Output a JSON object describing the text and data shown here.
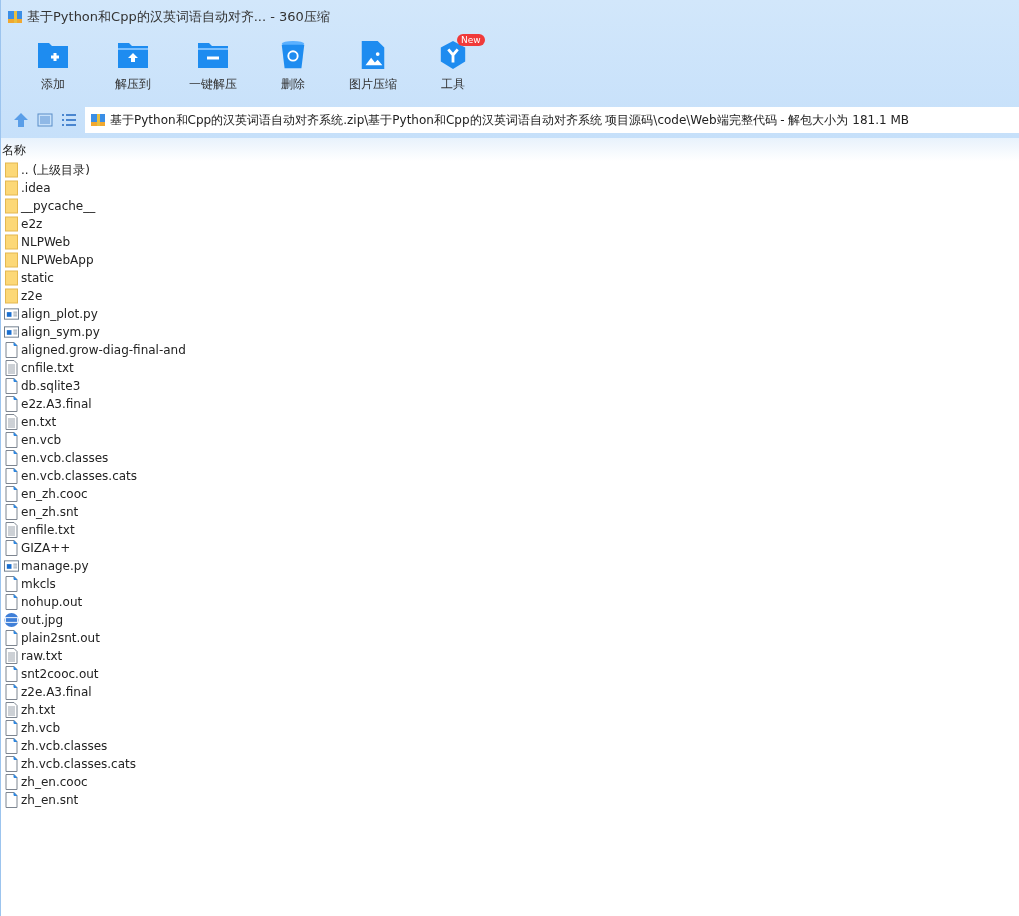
{
  "window": {
    "title": "基于Python和Cpp的汉英词语自动对齐... - 360压缩"
  },
  "toolbar": [
    {
      "kind": "add",
      "label": "添加"
    },
    {
      "kind": "extract",
      "label": "解压到"
    },
    {
      "kind": "oneclick",
      "label": "一键解压"
    },
    {
      "kind": "delete",
      "label": "删除"
    },
    {
      "kind": "image",
      "label": "图片压缩"
    },
    {
      "kind": "tools",
      "label": "工具",
      "badge": "New"
    }
  ],
  "address_bar": {
    "path": "基于Python和Cpp的汉英词语自动对齐系统.zip\\基于Python和Cpp的汉英词语自动对齐系统 项目源码\\code\\Web端完整代码 - 解包大小为 181.1 MB"
  },
  "file_list": {
    "columns": [
      "名称"
    ],
    "rows": [
      {
        "kind": "folder",
        "name": ".. (上级目录)"
      },
      {
        "kind": "folder",
        "name": ".idea"
      },
      {
        "kind": "folder",
        "name": "__pycache__"
      },
      {
        "kind": "folder",
        "name": "e2z"
      },
      {
        "kind": "folder",
        "name": "NLPWeb"
      },
      {
        "kind": "folder",
        "name": "NLPWebApp"
      },
      {
        "kind": "folder",
        "name": "static"
      },
      {
        "kind": "folder",
        "name": "z2e"
      },
      {
        "kind": "python",
        "name": "align_plot.py"
      },
      {
        "kind": "python",
        "name": "align_sym.py"
      },
      {
        "kind": "file",
        "name": "aligned.grow-diag-final-and"
      },
      {
        "kind": "text",
        "name": "cnfile.txt"
      },
      {
        "kind": "file",
        "name": "db.sqlite3"
      },
      {
        "kind": "file",
        "name": "e2z.A3.final"
      },
      {
        "kind": "text",
        "name": "en.txt"
      },
      {
        "kind": "file",
        "name": "en.vcb"
      },
      {
        "kind": "file",
        "name": "en.vcb.classes"
      },
      {
        "kind": "file",
        "name": "en.vcb.classes.cats"
      },
      {
        "kind": "file",
        "name": "en_zh.cooc"
      },
      {
        "kind": "file",
        "name": "en_zh.snt"
      },
      {
        "kind": "text",
        "name": "enfile.txt"
      },
      {
        "kind": "file",
        "name": "GIZA++"
      },
      {
        "kind": "python",
        "name": "manage.py"
      },
      {
        "kind": "file",
        "name": "mkcls"
      },
      {
        "kind": "file",
        "name": "nohup.out"
      },
      {
        "kind": "image",
        "name": "out.jpg"
      },
      {
        "kind": "file",
        "name": "plain2snt.out"
      },
      {
        "kind": "text",
        "name": "raw.txt"
      },
      {
        "kind": "file",
        "name": "snt2cooc.out"
      },
      {
        "kind": "file",
        "name": "z2e.A3.final"
      },
      {
        "kind": "text",
        "name": "zh.txt"
      },
      {
        "kind": "file",
        "name": "zh.vcb"
      },
      {
        "kind": "file",
        "name": "zh.vcb.classes"
      },
      {
        "kind": "file",
        "name": "zh.vcb.classes.cats"
      },
      {
        "kind": "file",
        "name": "zh_en.cooc"
      },
      {
        "kind": "file",
        "name": "zh_en.snt"
      }
    ]
  }
}
